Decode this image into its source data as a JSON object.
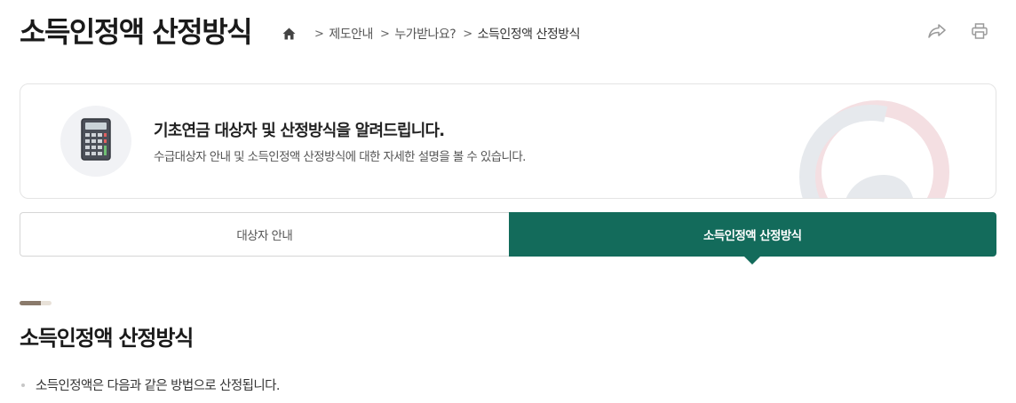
{
  "header": {
    "title": "소득인정액 산정방식",
    "breadcrumb": {
      "home_icon": "home-icon",
      "items": [
        "제도안내",
        "누가받나요?",
        "소득인정액 산정방식"
      ]
    },
    "actions": [
      {
        "name": "share",
        "icon": "share-icon"
      },
      {
        "name": "print",
        "icon": "print-icon"
      }
    ]
  },
  "intro": {
    "icon": "calculator-icon",
    "heading": "기초연금 대상자 및 산정방식을 알려드립니다.",
    "description": "수급대상자 안내 및 소득인정액 산정방식에 대한 자세한 설명을 볼 수 있습니다."
  },
  "tabs": {
    "items": [
      {
        "label": "대상자 안내",
        "active": false
      },
      {
        "label": "소득인정액 산정방식",
        "active": true
      }
    ]
  },
  "section": {
    "title": "소득인정액 산정방식",
    "bullets": [
      "소득인정액은 다음과 같은 방법으로 산정됩니다."
    ]
  },
  "colors": {
    "accent": "#136b5b",
    "section_bar_dark": "#8a7a6b",
    "section_bar_light": "#e8e1d8"
  }
}
